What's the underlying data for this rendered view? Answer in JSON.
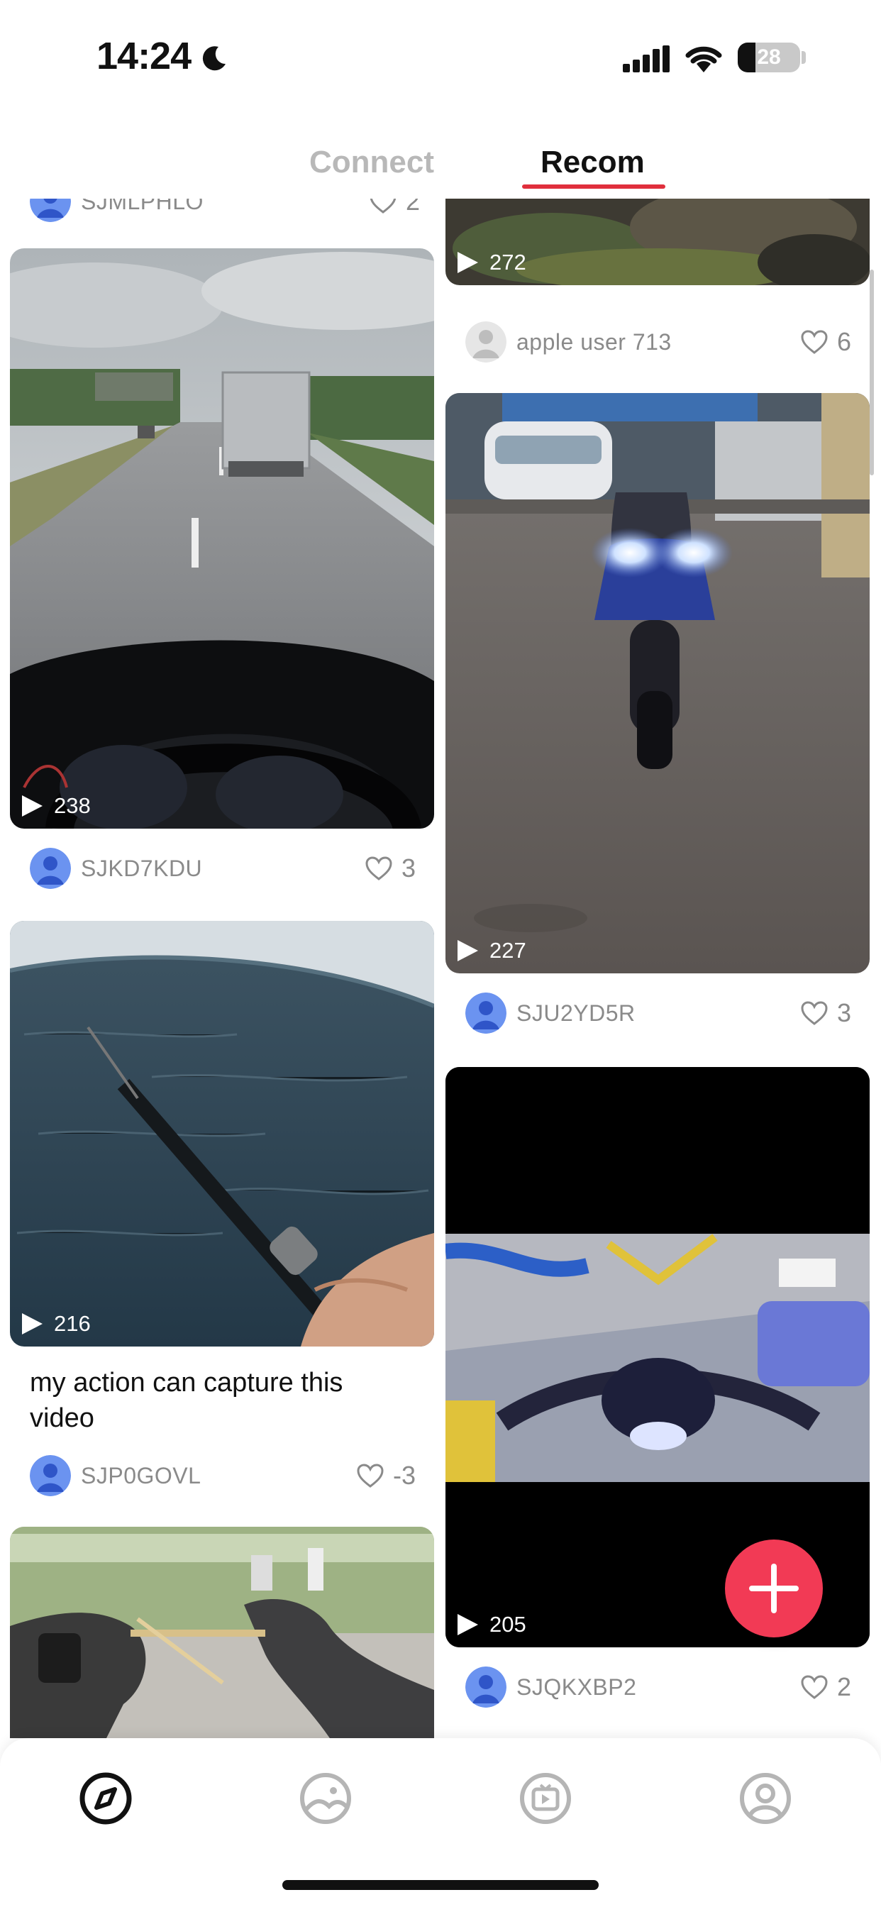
{
  "status_bar": {
    "time": "14:24",
    "battery": "28",
    "battery_level": 0.28,
    "icons": [
      "moon-icon",
      "signal-icon",
      "wifi-icon",
      "battery-icon"
    ]
  },
  "tabs": [
    {
      "label": "Connect",
      "active": false
    },
    {
      "label": "Recom",
      "active": true
    }
  ],
  "accent_color": "#e02f3c",
  "fab_color": "#f23a55",
  "feed": {
    "top_partial": {
      "author": "SJMLPHLO",
      "likes": "2"
    },
    "left_column": [
      {
        "views": "238",
        "author": "SJKD7KDU",
        "likes": "3",
        "caption": ""
      },
      {
        "views": "216",
        "author": "SJP0GOVL",
        "likes": "-3",
        "caption": "my action can capture this video"
      },
      {
        "views": "",
        "author": "",
        "likes": "",
        "caption": ""
      }
    ],
    "right_column": [
      {
        "views": "272",
        "author": "apple user 713",
        "likes": "6",
        "caption": ""
      },
      {
        "views": "227",
        "author": "SJU2YD5R",
        "likes": "3",
        "caption": ""
      },
      {
        "views": "205",
        "author": "SJQKXBP2",
        "likes": "2",
        "caption": ""
      }
    ]
  },
  "bottom_nav": [
    {
      "icon": "compass-icon",
      "active": true
    },
    {
      "icon": "community-icon",
      "active": false
    },
    {
      "icon": "video-icon",
      "active": false
    },
    {
      "icon": "profile-icon",
      "active": false
    }
  ]
}
